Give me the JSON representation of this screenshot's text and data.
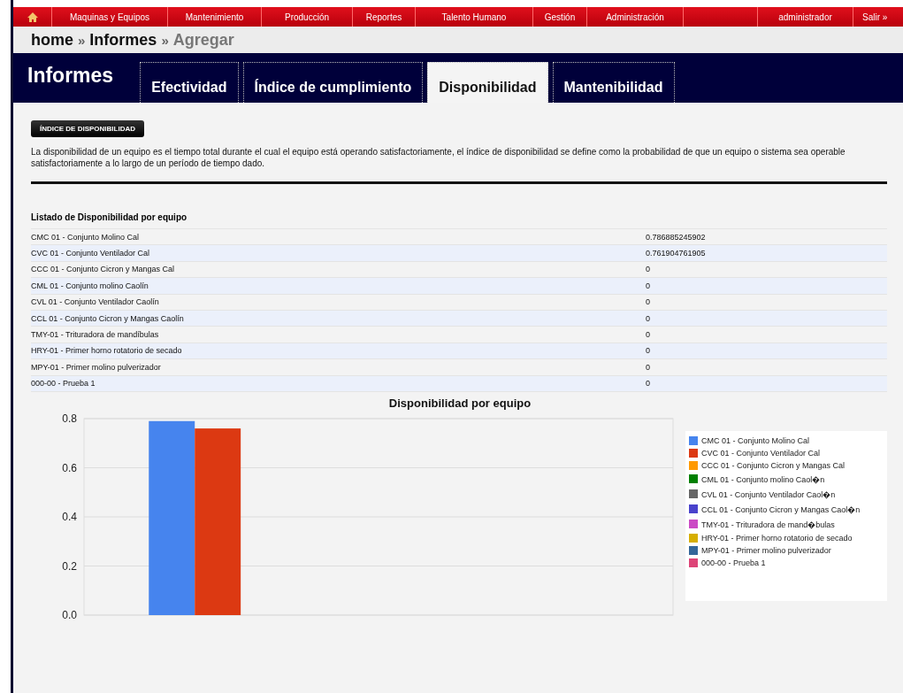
{
  "menu": {
    "items": [
      {
        "label": "Maquinas y Equipos"
      },
      {
        "label": "Mantenimiento"
      },
      {
        "label": "Producción"
      },
      {
        "label": "Reportes"
      },
      {
        "label": "Talento Humano"
      },
      {
        "label": "Gestión"
      },
      {
        "label": "Administración"
      }
    ],
    "user": "administrador",
    "logout": "Salir »"
  },
  "breadcrumb": [
    {
      "label": "home",
      "current": false
    },
    {
      "label": "Informes",
      "current": false
    },
    {
      "label": "Agregar",
      "current": true
    }
  ],
  "separator": "»",
  "header": {
    "title": "Informes",
    "tabs": [
      {
        "label": "Efectividad",
        "selected": false
      },
      {
        "label": "Índice de cumplimiento",
        "selected": false
      },
      {
        "label": "Disponibilidad",
        "selected": true
      },
      {
        "label": "Mantenibilidad",
        "selected": false
      }
    ]
  },
  "section_button": "ÍNDICE DE DISPONIBILIDAD",
  "description": "La disponibilidad de un equipo es el tiempo total durante el cual el equipo está operando satisfactoriamente, el índice de disponibilidad se define como la probabilidad de que un equipo o sistema sea operable satisfactoriamente a lo largo de un período de tiempo dado.",
  "table": {
    "title": "Listado de Disponibilidad por equipo",
    "rows": [
      [
        "CMC 01 - Conjunto Molino Cal",
        "0.786885245902"
      ],
      [
        "CVC 01 - Conjunto Ventilador Cal",
        "0.761904761905"
      ],
      [
        "CCC 01 - Conjunto Cicron y Mangas Cal",
        "0"
      ],
      [
        "CML 01 - Conjunto molino Caolín",
        "0"
      ],
      [
        "CVL 01 - Conjunto Ventilador Caolín",
        "0"
      ],
      [
        "CCL 01 - Conjunto Cicron y Mangas Caolín",
        "0"
      ],
      [
        "TMY-01 - Trituradora de mandíbulas",
        "0"
      ],
      [
        "HRY-01 - Primer horno rotatorio de secado",
        "0"
      ],
      [
        "MPY-01 - Primer molino pulverizador",
        "0"
      ],
      [
        "000-00 - Prueba 1",
        "0"
      ]
    ]
  },
  "chart": {
    "chart_data": {
      "type": "bar",
      "grid": true,
      "title": "Disponibilidad por equipo",
      "ylim": [
        0,
        0.8
      ],
      "yticks": [
        {
          "value": 0,
          "label": "0.0"
        },
        {
          "value": 0.2,
          "label": "0.2"
        },
        {
          "value": 0.4,
          "label": "0.4"
        },
        {
          "value": 0.6,
          "label": "0.6"
        },
        {
          "value": 0.8,
          "label": "0.8"
        }
      ],
      "series": [
        {
          "name": "CMC 01 - Conjunto Molino Cal",
          "color": "#4684ee",
          "values": [
            0.79
          ]
        },
        {
          "name": "CVC 01 - Conjunto Ventilador Cal",
          "color": "#dc3912",
          "values": [
            0.76
          ]
        },
        {
          "name": "CCC 01 - Conjunto Cicron y Mangas Cal",
          "color": "#ff9900",
          "values": [
            0
          ]
        },
        {
          "name": "CML 01 - Conjunto molino Caol�n",
          "color": "#008000",
          "values": [
            0
          ]
        },
        {
          "name": "CVL 01 - Conjunto Ventilador Caol�n",
          "color": "#666666",
          "values": [
            0
          ]
        },
        {
          "name": "CCL 01 - Conjunto Cicron y Mangas Caol�n",
          "color": "#4942cc",
          "values": [
            0
          ]
        },
        {
          "name": "TMY-01 - Trituradora de mand�bulas",
          "color": "#cb4ac5",
          "values": [
            0
          ]
        },
        {
          "name": "HRY-01 - Primer horno rotatorio de secado",
          "color": "#d6ae00",
          "values": [
            0
          ]
        },
        {
          "name": "MPY-01 - Primer molino pulverizador",
          "color": "#336699",
          "values": [
            0
          ]
        },
        {
          "name": "000-00 - Prueba 1",
          "color": "#dd4477",
          "values": [
            0
          ]
        }
      ]
    }
  }
}
